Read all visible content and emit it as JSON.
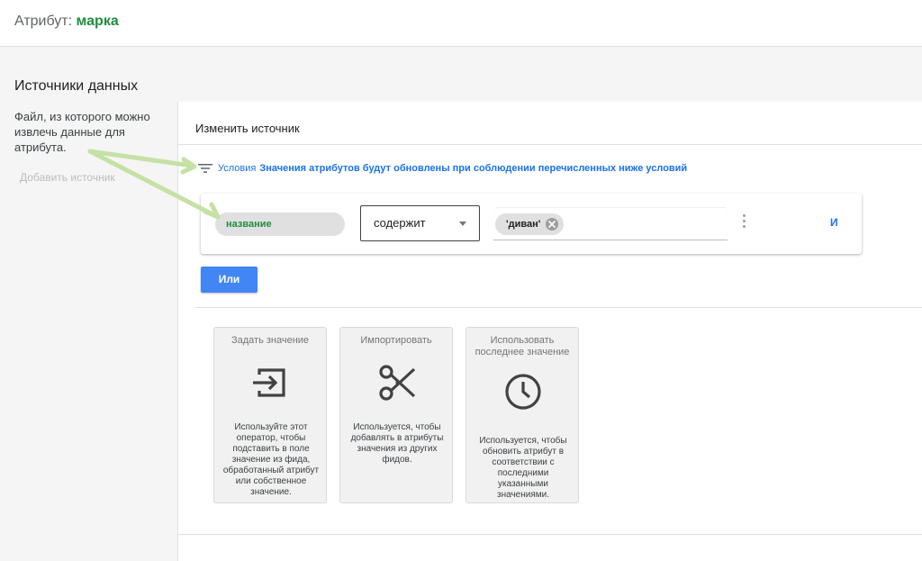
{
  "header": {
    "title_prefix": "Атрибут:",
    "attribute_name": "марка"
  },
  "sidebar": {
    "title": "Источники данных",
    "description": "Файл, из которого можно извлечь данные для атрибута.",
    "add_source": "Добавить источник"
  },
  "panel": {
    "heading": "Изменить источник",
    "conditions_label": "Условия",
    "conditions_text": "Значения атрибутов будут обновлены при соблюдении перечисленных ниже условий",
    "condition": {
      "field": "название",
      "operator": "содержит",
      "value_chip": "'диван'",
      "and_label": "И"
    },
    "or_button": "Или",
    "cards": [
      {
        "title": "Задать значение",
        "icon": "input-arrow-icon",
        "description": "Используйте этот оператор, чтобы подставить в поле значение из фида, обработанный атрибут или собственное значение."
      },
      {
        "title": "Импортировать",
        "icon": "scissors-icon",
        "description": "Используется, чтобы добавлять в атрибуты значения из других фидов."
      },
      {
        "title": "Использовать последнее значение",
        "icon": "clock-icon",
        "description": "Используется, чтобы обновить атрибут в соответствии с последними указанными значениями."
      }
    ]
  },
  "colors": {
    "accent_green": "#1e8e3e",
    "link_blue": "#1a73e8",
    "button_blue": "#4285f4",
    "annotation_arrow": "#c5e1a5"
  }
}
